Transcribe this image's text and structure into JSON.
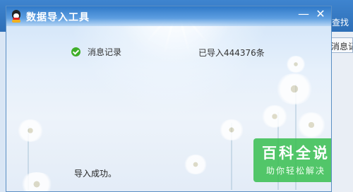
{
  "background_app": {
    "search_label": "查找",
    "side_tab_label": "消息记录"
  },
  "dialog": {
    "title": "数据导入工具",
    "minimize_glyph": "—",
    "close_glyph": "✕",
    "icon": "qq-penguin-icon",
    "items": [
      {
        "label": "消息记录",
        "status": "已导入444376条",
        "icon": "check-circle-icon"
      }
    ],
    "result_text": "导入成功。"
  },
  "watermark": {
    "title": "百科全说",
    "subtitle": "助你轻松解决"
  },
  "colors": {
    "titlebar": "#2f79c8",
    "check": "#3fae29",
    "watermark": "#37be50"
  }
}
